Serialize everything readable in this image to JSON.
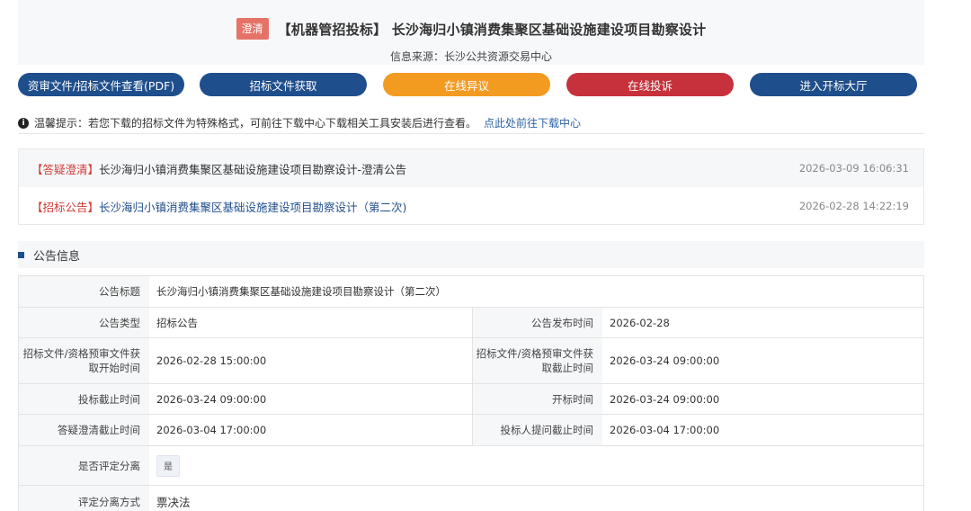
{
  "header": {
    "badge": "澄清",
    "title": "【机器管招投标】 长沙海归小镇消费集聚区基础设施建设项目勘察设计",
    "source": "信息来源：长沙公共资源交易中心"
  },
  "buttons": [
    {
      "label": "资审文件/招标文件查看(PDF)",
      "color": "#1f4e8c"
    },
    {
      "label": "招标文件获取",
      "color": "#1f4e8c"
    },
    {
      "label": "在线异议",
      "color": "#f39a21"
    },
    {
      "label": "在线投诉",
      "color": "#c6313b"
    },
    {
      "label": "进入开标大厅",
      "color": "#1f4e8c"
    }
  ],
  "tip": {
    "icon": "info-icon",
    "text": "温馨提示：若您下载的招标文件为特殊格式，可前往下载中心下载相关工具安装后进行查看。",
    "link": "点此处前往下载中心"
  },
  "notices": [
    {
      "tag": "【答疑澄清】",
      "title": "长沙海归小镇消费集聚区基础设施建设项目勘察设计-澄清公告",
      "date": "2026-03-09 16:06:31"
    },
    {
      "tag": "【招标公告】",
      "title": "长沙海归小镇消费集聚区基础设施建设项目勘察设计（第二次)",
      "date": "2026-02-28 14:22:19"
    }
  ],
  "section": {
    "title": "公告信息"
  },
  "info": {
    "title_label": "公告标题",
    "title_value": "长沙海归小镇消费集聚区基础设施建设项目勘察设计（第二次）",
    "type_label": "公告类型",
    "type_value": "招标公告",
    "publish_label": "公告发布时间",
    "publish_value": "2026-02-28",
    "get_start_label": "招标文件/资格预审文件获取开始时间",
    "get_start_value": "2026-02-28 15:00:00",
    "get_end_label": "招标文件/资格预审文件获取截止时间",
    "get_end_value": "2026-03-24 09:00:00",
    "bid_deadline_label": "投标截止时间",
    "bid_deadline_value": "2026-03-24 09:00:00",
    "open_label": "开标时间",
    "open_value": "2026-03-24 09:00:00",
    "clarify_deadline_label": "答疑澄清截止时间",
    "clarify_deadline_value": "2026-03-04 17:00:00",
    "question_deadline_label": "投标人提问截止时间",
    "question_deadline_value": "2026-03-04 17:00:00",
    "separation_label": "是否评定分离",
    "separation_value": "是",
    "method_label": "评定分离方式",
    "method_value": "票决法"
  }
}
